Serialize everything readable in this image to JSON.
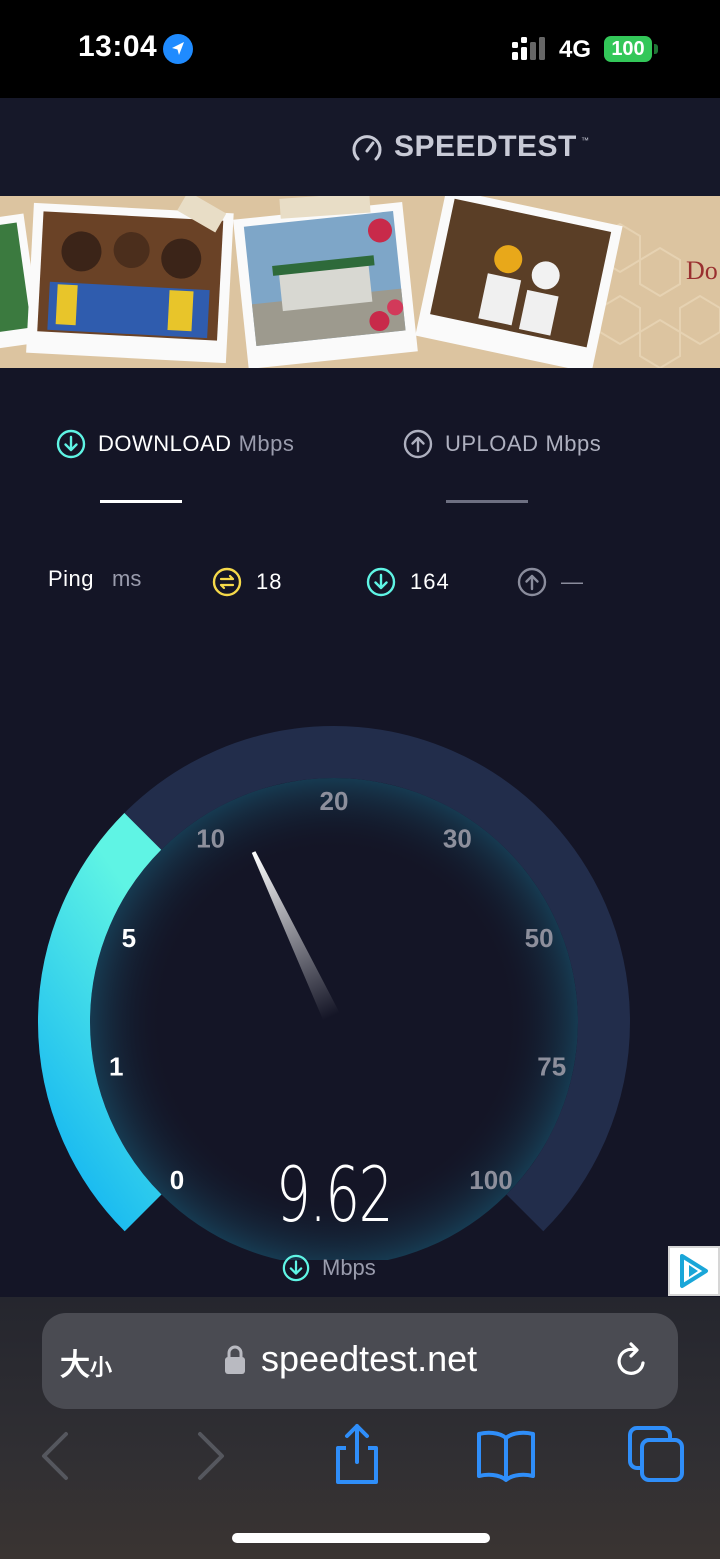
{
  "status_bar": {
    "time": "13:04",
    "network": "4G",
    "battery": "100"
  },
  "header": {
    "brand": "SPEEDTEST",
    "brand_mark": "™"
  },
  "ad": {
    "text_fragment": "Do"
  },
  "tabs": {
    "download_label": "DOWNLOAD",
    "download_unit": "Mbps",
    "upload_label": "UPLOAD",
    "upload_unit": "Mbps"
  },
  "ping": {
    "label": "Ping",
    "unit": "ms",
    "ping_value": "18",
    "download_value": "164",
    "upload_value": "—"
  },
  "gauge": {
    "ticks": [
      "0",
      "1",
      "5",
      "10",
      "20",
      "30",
      "50",
      "75",
      "100"
    ],
    "current_value": "9.62",
    "current_unit": "Mbps",
    "fill_fraction": 0.333,
    "needle_tick_position": 3.25,
    "colors": {
      "track": "#222d4b",
      "fill_start": "#10b2f2",
      "fill_end": "#5ff4e4",
      "background": "#141526"
    }
  },
  "browser": {
    "text_size_label_big": "大",
    "text_size_label_small": "小",
    "url": "speedtest.net"
  },
  "icons": {
    "status": [
      "location-arrow-icon",
      "signal-bars-icon",
      "battery-icon"
    ],
    "header": [
      "speedometer-icon"
    ],
    "toolbar": [
      "back-icon",
      "forward-icon",
      "share-icon",
      "bookmarks-icon",
      "tabs-icon",
      "lock-icon",
      "reload-icon"
    ]
  }
}
